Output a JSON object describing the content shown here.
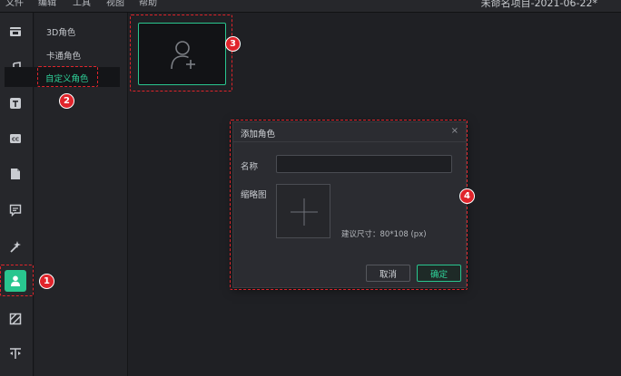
{
  "menu": {
    "items": [
      "文件",
      "编辑",
      "工具",
      "视图",
      "帮助"
    ],
    "window_title": "未命名项目-2021-06-22*"
  },
  "toolbar": {
    "icons": [
      "media-icon",
      "music-icon",
      "text-icon",
      "caption-icon",
      "folder-icon",
      "comment-icon",
      "effects-icon",
      "character-icon",
      "filter-icon",
      "split-icon"
    ],
    "active": "character-icon"
  },
  "categories": {
    "items": [
      "3D角色",
      "卡通角色",
      "自定义角色"
    ],
    "selected": "自定义角色"
  },
  "dialog": {
    "title": "添加角色",
    "close": "×",
    "name_label": "名称",
    "name_value": "",
    "thumb_label": "缩略图",
    "size_hint": "建议尺寸：80*108 (px)",
    "cancel": "取消",
    "ok": "确定"
  },
  "annotations": [
    "1",
    "2",
    "3",
    "4"
  ],
  "colors": {
    "accent": "#29c68f",
    "annotation": "#e0242b",
    "background": "#1f2024"
  }
}
